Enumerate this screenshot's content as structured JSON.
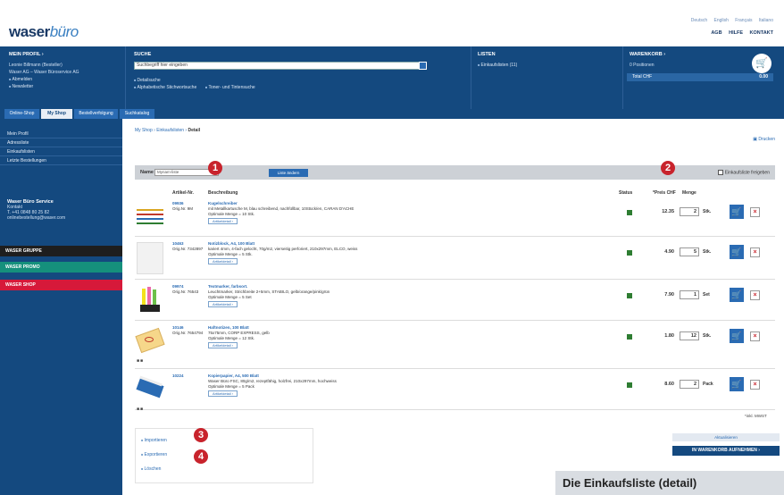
{
  "header": {
    "logo_bold": "waser",
    "logo_light": "büro",
    "languages": [
      "Deutsch",
      "English",
      "Français",
      "Italiano"
    ],
    "utility_links": [
      "AGB",
      "HILFE",
      "KONTAKT"
    ]
  },
  "band": {
    "profile": {
      "title": "MEIN PROFIL ›",
      "lines": [
        "Leonie Billmann (Besteller)",
        "Waser AG – Waser Büroservice AG"
      ],
      "links": [
        "Abmelden",
        "Newsletter"
      ]
    },
    "search": {
      "title": "SUCHE",
      "placeholder": "Suchbegriff hier eingeben",
      "links": [
        "Detailsuche",
        "Alphabetische Stichwortsuche",
        "Toner- und Tintensuche"
      ]
    },
    "lists": {
      "title": "LISTEN",
      "link": "Einkaufslisten (11)"
    },
    "basket": {
      "title": "WARENKORB ›",
      "sub": "0 Positionen",
      "total_label": "Total CHF",
      "total_value": "0.00"
    }
  },
  "tabs": [
    "Online-Shop",
    "My Shop",
    "Bestellverfolgung",
    "Suchkatalog"
  ],
  "sidebar": {
    "items": [
      "Mein Profil",
      "Adressliste",
      "Einkaufslisten",
      "Letzte Bestellungen"
    ],
    "contact": {
      "title": "Waser Büro Service",
      "lines": [
        "Kontakt",
        "T. +41 0848 80 25 82",
        "onlinebestellung@waser.com"
      ]
    },
    "boxes": [
      "WASER GRUPPE",
      "WASER PROMO",
      "WASER SHOP"
    ]
  },
  "content": {
    "breadcrumb": {
      "parts": [
        "My Shop",
        "Einkaufslisten"
      ],
      "current": "Detail"
    },
    "print_label": "Drucken",
    "filter": {
      "label": "Name",
      "value": "Mynam-liste",
      "button": "Liste ändern",
      "checkbox_label": "Einkaufsliste freigeben"
    },
    "columns": {
      "article": "Artikel-Nr.",
      "description": "Beschreibung",
      "status": "Status",
      "price": "*Preis CHF",
      "qty": "Menge"
    },
    "rows": [
      {
        "no": "09936",
        "sub": "Orig.Nr. 9M",
        "name": "Kugelschreiber",
        "line": "mit Metallkartusche M, blau schreibend, nachfüllbar, 10Stück/en, CARAN D'ACHE",
        "min": "Optimale Menge = 10 Stk.",
        "more": "Artikeldetail ›",
        "price": "12.35",
        "qty": "2",
        "unit": "Stk."
      },
      {
        "no": "10463",
        "sub": "Orig.Nr. 7342897",
        "name": "Notizblock, A4, 100 Blatt",
        "line": "kariert 4mm, 4-fach gelocht, 70g/m2, vierseitig perforiert, 210x297mm, ELCO, weiss",
        "min": "Optimale Menge = 5 Stk.",
        "more": "Artikeldetail ›",
        "price": "4.90",
        "qty": "5",
        "unit": "Stk."
      },
      {
        "no": "09974",
        "sub": "Orig.Nr. 76543",
        "name": "Textmarker, farbsort.",
        "line": "Leuchtmarker, Strichbreite 2+5mm, STABILO, gelb/orange/pink/grün",
        "min": "Optimale Menge = 5 Set",
        "more": "Artikeldetail ›",
        "price": "7.90",
        "qty": "1",
        "unit": "Set"
      },
      {
        "no": "10146",
        "sub": "Orig.Nr. 7654794",
        "name": "Haftnotizen, 100 Blatt",
        "line": "75x75mm, CORP EXPRESS, gelb",
        "min": "Optimale Menge = 12 Stk.",
        "more": "Artikeldetail ›",
        "price": "1.80",
        "qty": "12",
        "unit": "Stk."
      },
      {
        "no": "10224",
        "sub": "",
        "name": "Kopierpapier, A4, 500 Blatt",
        "line": "Waser Büro FSC, 80g/m2, rezeptfähig, holzfrei, 210x297mm, hochweiss",
        "min": "Optimale Menge = 5 Pack",
        "more": "Artikeldetail ›",
        "price": "8.60",
        "qty": "2",
        "unit": "Pack"
      }
    ],
    "vat_note": "*inkl. MWST",
    "actions": [
      "Importieren",
      "Exportieren",
      "Löschen"
    ],
    "order": {
      "sub": "Aktualisieren",
      "button": "IN WARENKORB AUFNEHMEN ›"
    }
  },
  "badges": [
    "1",
    "2",
    "3",
    "4"
  ],
  "caption": "Die Einkaufsliste (detail)",
  "colors": {
    "brand_blue": "#14497f",
    "accent_blue": "#2a6bb3",
    "badge_red": "#c8232c",
    "status_green": "#2e7d32"
  }
}
